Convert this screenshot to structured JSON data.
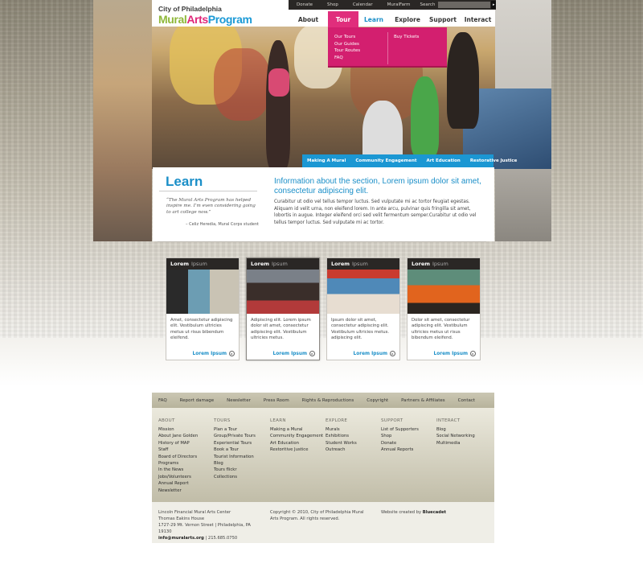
{
  "brand": {
    "org": "City of Philadelphia",
    "name_part1": "Mural",
    "name_part2": "Arts",
    "name_part3": "Program",
    "colors": {
      "green": "#8fb83a",
      "pink": "#e0277a",
      "blue": "#1c9ad6"
    }
  },
  "utility_nav": {
    "items": [
      "Donate",
      "Shop",
      "Calendar",
      "MuralFarm"
    ],
    "search_label": "Search",
    "search_placeholder": "",
    "search_button_icon": "arrow-right-icon"
  },
  "main_nav": {
    "items": [
      "About",
      "Tour",
      "Learn",
      "Explore",
      "Support",
      "Interact"
    ],
    "active_hover": "Tour",
    "current": "Learn"
  },
  "tour_dropdown": {
    "col1": [
      "Our Tours",
      "Our Guides",
      "Tour Routes",
      "FAQ"
    ],
    "col2": [
      "Buy Tickets"
    ]
  },
  "sub_nav": [
    "Making A Mural",
    "Community Engagement",
    "Art Education",
    "Restorative Justice"
  ],
  "section": {
    "title": "Learn",
    "quote": "“The Mural Arts Program has helped inspire me. I’m even considering going to art college now.”",
    "quote_attr": "– Celiz Heredia, Mural Corps student",
    "heading": "Information about the section, Lorem ipsum dolor sit amet, consectetur adipiscing elit.",
    "body": "Curabitur ut odio vel tellus tempor luctus. Sed vulputate mi ac tortor feugiat egestas. Aliquam id velit urna, non eleifend lorem. In ante arcu, pulvinar quis fringilla sit amet, lobortis in augue. Integer eleifend orci sed velit fermentum semper.Curabitur ut odio vel tellus tempor luctus. Sed vulputate mi ac tortor."
  },
  "cards": [
    {
      "head1": "Lorem",
      "head2": "Ipsum",
      "text": "Amet, consectetur adipiscing elit. Vestibulum ultricies metus ut risus bibendum eleifend.",
      "link": "Lorem Ipsum"
    },
    {
      "head1": "Lorem",
      "head2": "Ipsum",
      "text": "Adipiscing elit. Lorem ipsum dolor sit amet, consectetur adipiscing elit. Vestibulum ultricies metus.",
      "link": "Lorem Ipsum"
    },
    {
      "head1": "Lorem",
      "head2": "Ipsum",
      "text": "Ipsum dolor sit amet, consectetur adipiscing elit. Vestibulum ultricies metus. adipiscing elit.",
      "link": "Lorem Ipsum"
    },
    {
      "head1": "Lorem",
      "head2": "Ipsum",
      "text": "Dolor sit amet, consectetur adipiscing elit. Vestibulum ultricies metus ut risus bibendum eleifend.",
      "link": "Lorem Ipsum"
    }
  ],
  "footer_bar": [
    "FAQ",
    "Report damage",
    "Newsletter",
    "Press Room",
    "Rights & Reproductions",
    "Copyright",
    "Partners & Affiliates",
    "Contact"
  ],
  "footer_columns": [
    {
      "heading": "ABOUT",
      "items": [
        "Mission",
        "About Jane Golden",
        "History of MAP",
        "Staff",
        "Board of Directors",
        "Programs",
        "In the News",
        "Jobs/Volunteers",
        "Annual Report",
        "Newsletter"
      ]
    },
    {
      "heading": "TOURS",
      "items": [
        "Plan a Tour",
        "Group/Private Tours",
        "Experiential Tours",
        "Book a Tour",
        "Tourist Information",
        "Blog",
        "Tours flickr",
        "Collections"
      ]
    },
    {
      "heading": "LEARN",
      "items": [
        "Making a Mural",
        "Community Engagement",
        "Art Education",
        "Restoritive Justice"
      ]
    },
    {
      "heading": "EXPLORE",
      "items": [
        "Murals",
        "Exhibitions",
        "Student Works",
        "Outreach"
      ]
    },
    {
      "heading": "SUPPORT",
      "items": [
        "List of Supporters",
        "Shop",
        "Donate",
        "Annual Reports"
      ]
    },
    {
      "heading": "INTERACT",
      "items": [
        "Blog",
        "Social Networking",
        "Multimedia"
      ]
    }
  ],
  "footer_bottom": {
    "address_line1": "Lincoln Financial Mural Arts Center",
    "address_line2": "Thomas Eakins House",
    "address_line3": "1727-29 Mt. Vernon Street | Philadelphia, PA 19130",
    "email": "info@muralarts.org",
    "phone": " | 215.685.0750",
    "copyright": "Copyright © 2010, City of Philadelphia Mural Arts Program. All rights reserved.",
    "credit_prefix": "Website created by ",
    "credit_name": "Bluecadet"
  }
}
